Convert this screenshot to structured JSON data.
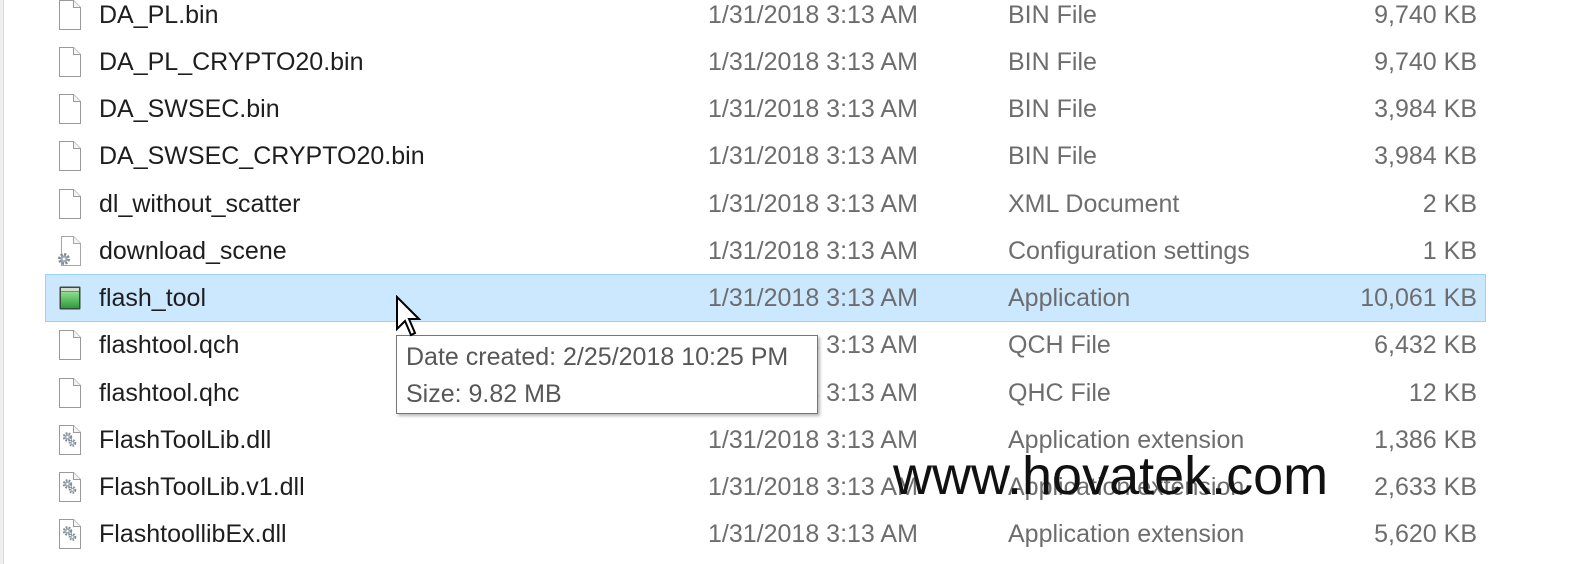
{
  "files": [
    {
      "name": "DA_PL.bin",
      "date_modified": "1/31/2018 3:13 AM",
      "type": "BIN File",
      "size": "9,740 KB",
      "icon": "file-icon"
    },
    {
      "name": "DA_PL_CRYPTO20.bin",
      "date_modified": "1/31/2018 3:13 AM",
      "type": "BIN File",
      "size": "9,740 KB",
      "icon": "file-icon"
    },
    {
      "name": "DA_SWSEC.bin",
      "date_modified": "1/31/2018 3:13 AM",
      "type": "BIN File",
      "size": "3,984 KB",
      "icon": "file-icon"
    },
    {
      "name": "DA_SWSEC_CRYPTO20.bin",
      "date_modified": "1/31/2018 3:13 AM",
      "type": "BIN File",
      "size": "3,984 KB",
      "icon": "file-icon"
    },
    {
      "name": "dl_without_scatter",
      "date_modified": "1/31/2018 3:13 AM",
      "type": "XML Document",
      "size": "2 KB",
      "icon": "file-icon"
    },
    {
      "name": "download_scene",
      "date_modified": "1/31/2018 3:13 AM",
      "type": "Configuration settings",
      "size": "1 KB",
      "icon": "settings-file-icon"
    },
    {
      "name": "flash_tool",
      "date_modified": "1/31/2018 3:13 AM",
      "type": "Application",
      "size": "10,061 KB",
      "icon": "application-icon",
      "selected": true
    },
    {
      "name": "flashtool.qch",
      "date_modified": "1/31/2018 3:13 AM",
      "type": "QCH File",
      "size": "6,432 KB",
      "icon": "file-icon"
    },
    {
      "name": "flashtool.qhc",
      "date_modified": "1/31/2018 3:13 AM",
      "type": "QHC File",
      "size": "12 KB",
      "icon": "file-icon"
    },
    {
      "name": "FlashToolLib.dll",
      "date_modified": "1/31/2018 3:13 AM",
      "type": "Application extension",
      "size": "1,386 KB",
      "icon": "dll-file-icon"
    },
    {
      "name": "FlashToolLib.v1.dll",
      "date_modified": "1/31/2018 3:13 AM",
      "type": "Application extension",
      "size": "2,633 KB",
      "icon": "dll-file-icon"
    },
    {
      "name": "FlashtoollibEx.dll",
      "date_modified": "1/31/2018 3:13 AM",
      "type": "Application extension",
      "size": "5,620 KB",
      "icon": "dll-file-icon"
    }
  ],
  "tooltip": {
    "date_created": "Date created: 2/25/2018 10:25 PM",
    "size": "Size: 9.82 MB"
  },
  "watermark": "www.hovatek.com",
  "colors": {
    "selection_fill": "#cce8ff",
    "selection_border": "#99d1ff",
    "name_text": "#1e1e1e",
    "detail_text": "#6d6d6d",
    "tooltip_text": "#575757",
    "watermark_text": "#111111"
  }
}
